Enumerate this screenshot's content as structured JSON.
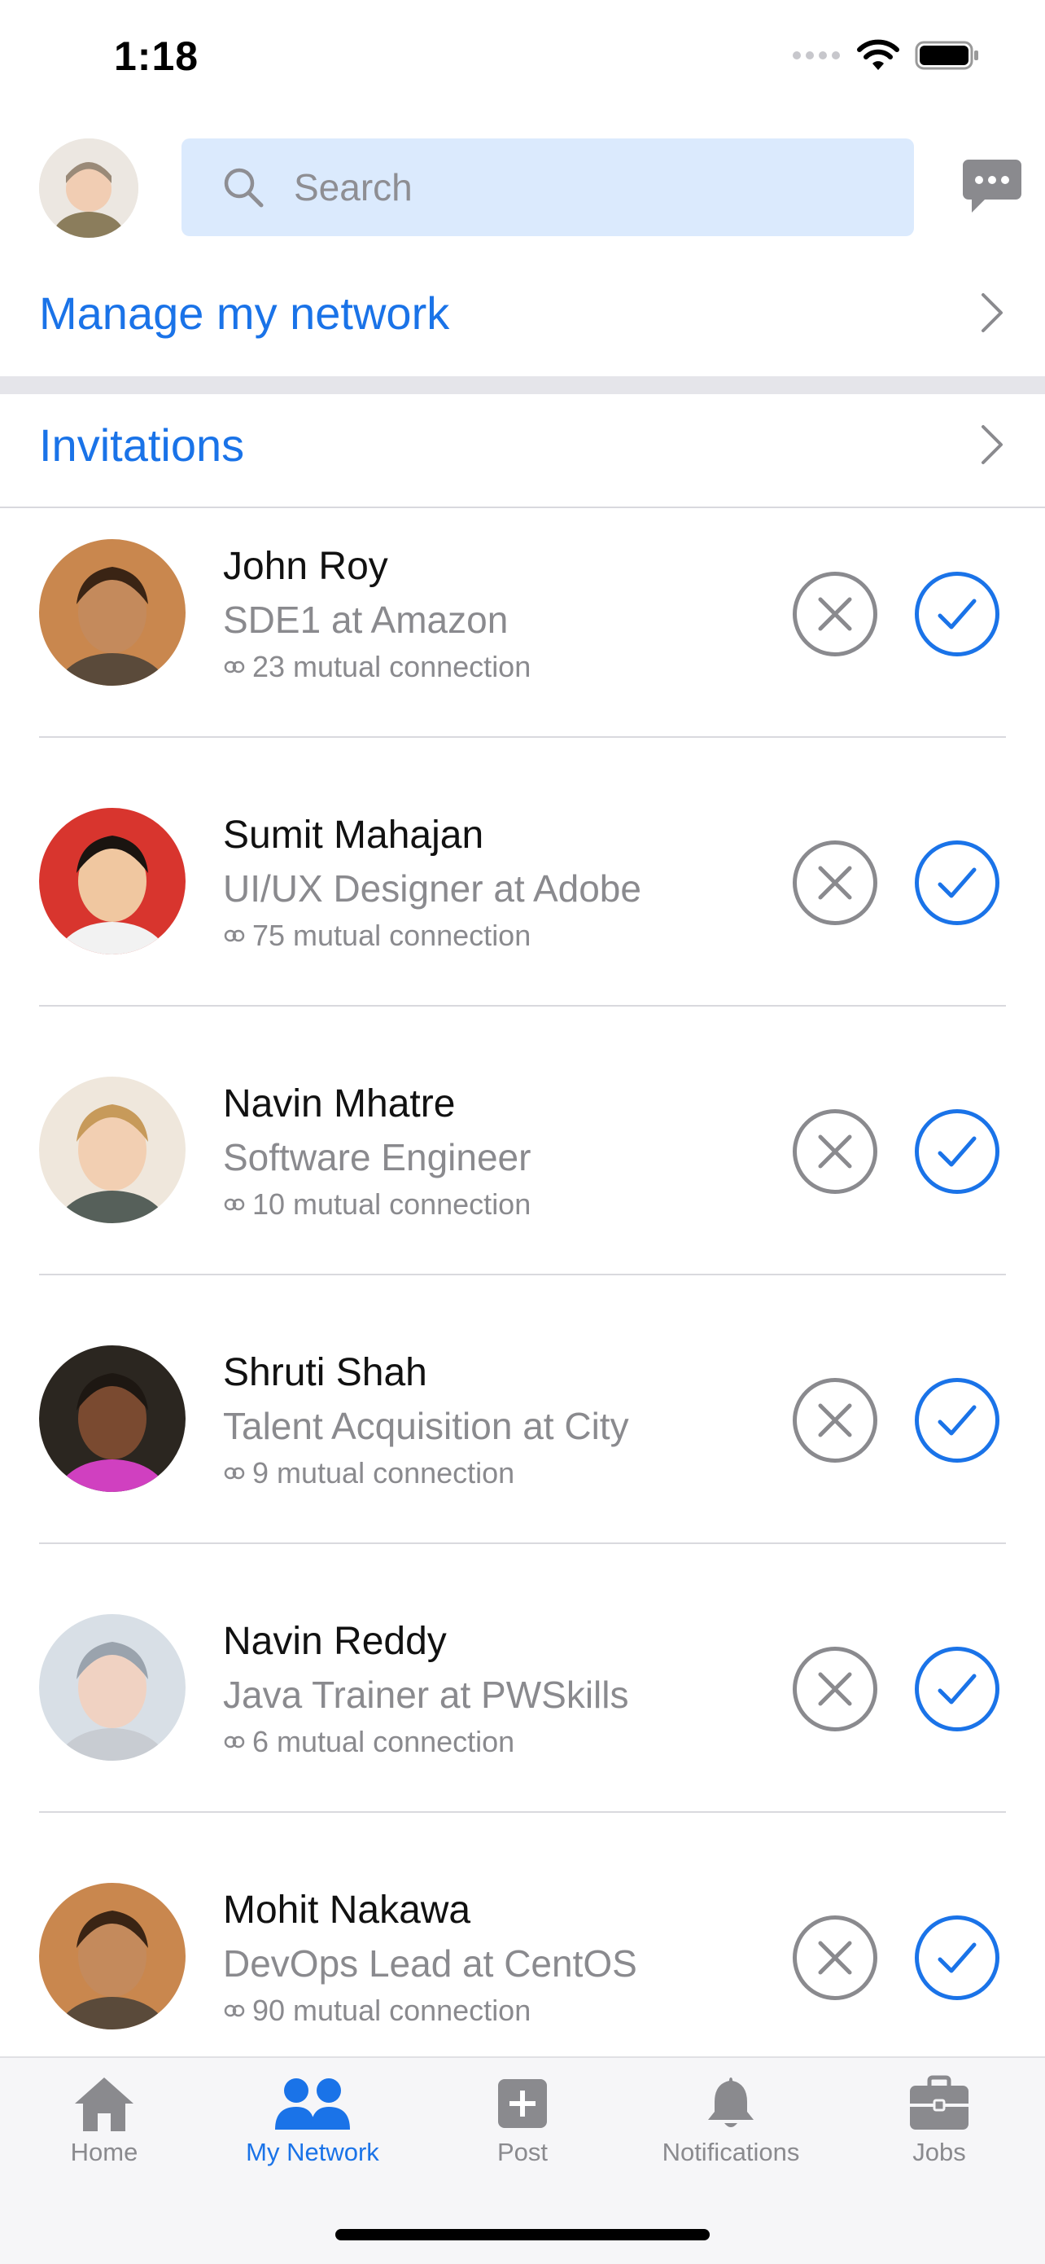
{
  "status_bar": {
    "time": "1:18"
  },
  "header": {
    "search_placeholder": "Search",
    "avatar": "profile-avatar",
    "messages_icon": "chat-bubble-icon"
  },
  "links": {
    "manage_network": "Manage my network",
    "invitations": "Invitations"
  },
  "invitations": [
    {
      "name": "John Roy",
      "title": "SDE1 at Amazon",
      "mutual": "23 mutual connection"
    },
    {
      "name": "Sumit Mahajan",
      "title": "UI/UX Designer at Adobe",
      "mutual": "75 mutual connection"
    },
    {
      "name": "Navin Mhatre",
      "title": "Software Engineer",
      "mutual": "10 mutual connection"
    },
    {
      "name": "Shruti Shah",
      "title": "Talent Acquisition at City",
      "mutual": "9 mutual connection"
    },
    {
      "name": "Navin Reddy",
      "title": "Java Trainer at PWSkills",
      "mutual": "6 mutual connection"
    },
    {
      "name": "Mohit Nakawa",
      "title": "DevOps Lead at CentOS",
      "mutual": "90 mutual connection"
    }
  ],
  "tabbar": {
    "home": "Home",
    "network": "My Network",
    "post": "Post",
    "notifications": "Notifications",
    "jobs": "Jobs",
    "active": "My Network"
  },
  "colors": {
    "accent": "#1a73e8",
    "muted": "#8a8a8e",
    "search_bg": "#dbeafd"
  }
}
